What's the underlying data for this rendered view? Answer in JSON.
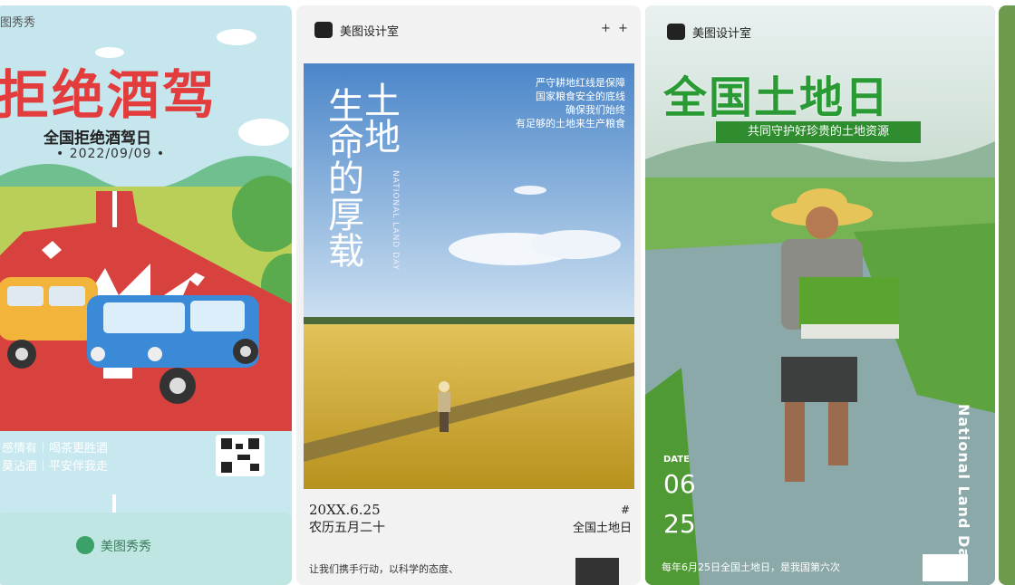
{
  "card1": {
    "brand": "图秀秀",
    "headline": "拒绝酒驾",
    "subtitle": "全国拒绝酒驾日",
    "date": "• 2022/09/09 •",
    "slogan_line1": "感情有｜喝茶更胜酒",
    "slogan_line2": "莫沾酒｜平安伴我走"
  },
  "card1b": {
    "brand": "美图秀秀"
  },
  "card2": {
    "header": "美图设计室",
    "menu": "+ +",
    "big_col1": "生命的厚载",
    "big_col2": "土地",
    "poem": [
      "严守耕地红线是保障",
      "国家粮食安全的底线",
      "确保我们始终",
      "有足够的土地来生产粮食"
    ],
    "english": "NATIONAL LAND DAY",
    "date1": "20XX.6.25",
    "date2": "农历五月二十",
    "hash": "#",
    "event": "全国土地日",
    "bottom": "让我们携手行动，以科学的态度、"
  },
  "card3": {
    "header": "美图设计室",
    "headline": "全国土地日",
    "banner": "共同守护好珍贵的土地资源",
    "date_label": "DATE",
    "month": "06",
    "day": "25",
    "vertical": "National Land Day",
    "bottom": "每年6月25日全国土地日，是我国第六次"
  },
  "colors": {
    "red": "#e33c3c",
    "green": "#2a9a34"
  }
}
